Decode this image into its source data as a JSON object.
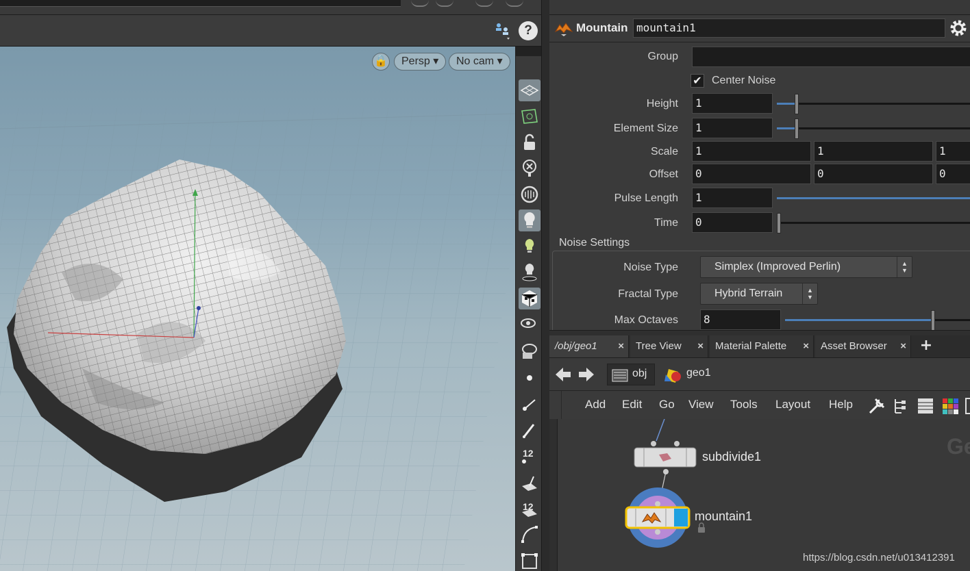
{
  "viewport": {
    "lock_label": "🔒",
    "persp_label": "Persp",
    "cam_label": "No cam",
    "help_label": "?",
    "toolbar_numbers": [
      "12",
      "12"
    ]
  },
  "parameters": {
    "node_type": "Mountain",
    "node_name": "mountain1",
    "group": {
      "label": "Group",
      "value": ""
    },
    "center_noise": {
      "label": "Center Noise",
      "checked": true,
      "mark": "✔"
    },
    "height": {
      "label": "Height",
      "value": "1",
      "slider": 0.1
    },
    "element_size": {
      "label": "Element Size",
      "value": "1",
      "slider": 0.1
    },
    "scale": {
      "label": "Scale",
      "values": [
        "1",
        "1",
        "1"
      ]
    },
    "offset": {
      "label": "Offset",
      "values": [
        "0",
        "0",
        "0"
      ]
    },
    "pulse_length": {
      "label": "Pulse Length",
      "value": "1",
      "slider": 1.0
    },
    "time": {
      "label": "Time",
      "value": "0",
      "slider": 0.0
    },
    "noise_settings": {
      "folder_label": "Noise Settings",
      "noise_type": {
        "label": "Noise Type",
        "value": "Simplex (Improved Perlin)"
      },
      "fractal_type": {
        "label": "Fractal Type",
        "value": "Hybrid Terrain"
      },
      "max_octaves": {
        "label": "Max Octaves",
        "value": "8",
        "slider": 0.8
      }
    }
  },
  "tabs": [
    {
      "label": "/obj/geo1",
      "close": "×",
      "active": true
    },
    {
      "label": "Tree View",
      "close": "×"
    },
    {
      "label": "Material Palette",
      "close": "×"
    },
    {
      "label": "Asset Browser",
      "close": "×"
    }
  ],
  "tab_add": "+",
  "path": {
    "root": "obj",
    "current": "geo1"
  },
  "network_menu": [
    "Add",
    "Edit",
    "Go",
    "View",
    "Tools",
    "Layout",
    "Help"
  ],
  "network": {
    "nodes": [
      {
        "name": "subdivide1"
      },
      {
        "name": "mountain1",
        "selected": true
      }
    ],
    "watermark": "Ge"
  },
  "credit": "https://blog.csdn.net/u013412391",
  "colors": {
    "accent_blue": "#4c7fb8",
    "node_selected": "#f2c200",
    "node_display": "#1ea0e0",
    "mountain_icon": "#e07a1a"
  }
}
